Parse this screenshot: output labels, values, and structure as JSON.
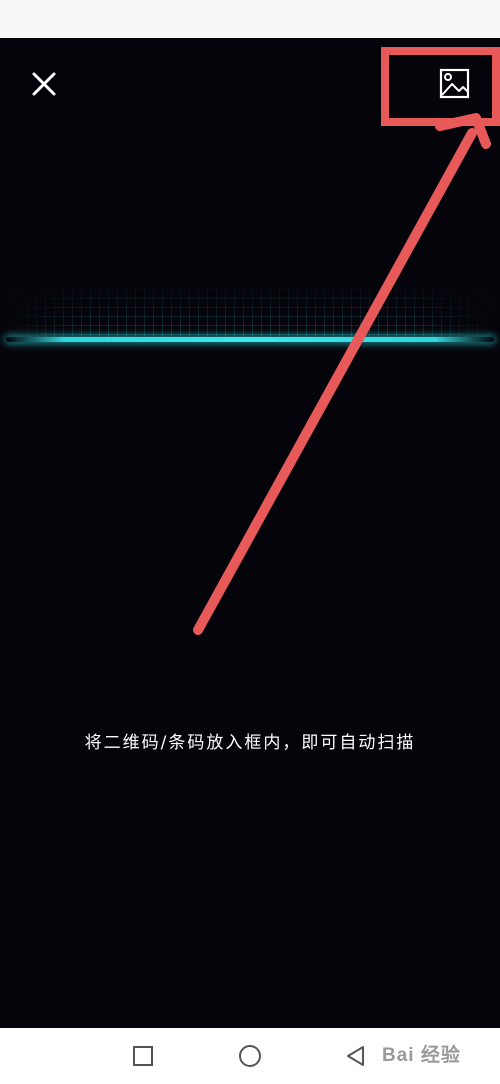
{
  "scanner": {
    "hint_text": "将二维码/条码放入框内，即可自动扫描",
    "close_icon": "close-icon",
    "gallery_icon": "image-icon",
    "scan_line_color": "#2fd6dc",
    "annotation_color": "#e85a5a"
  },
  "nav": {
    "recent_icon": "square-icon",
    "home_icon": "circle-icon",
    "back_icon": "triangle-back-icon"
  },
  "watermark": {
    "text": "Bai 经验"
  }
}
